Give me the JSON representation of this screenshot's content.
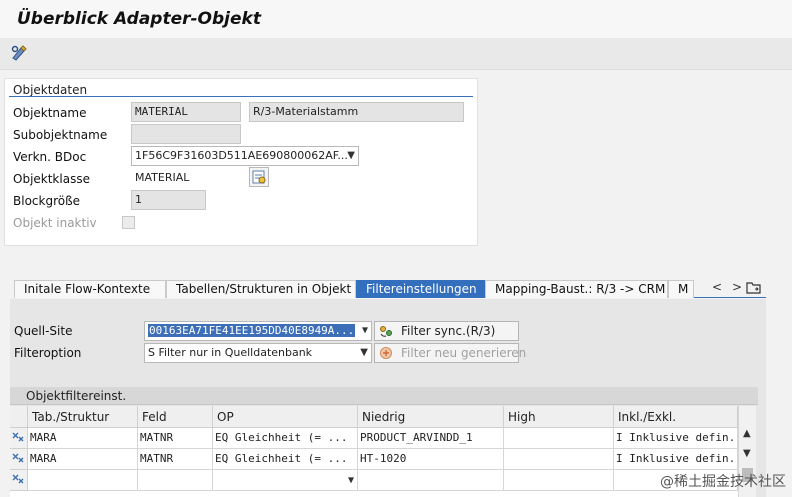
{
  "header": {
    "title": "Überblick Adapter-Objekt"
  },
  "toolbar": {
    "icon": "display-change-icon"
  },
  "objektdaten": {
    "section_title": "Objektdaten",
    "objektname": {
      "label": "Objektname",
      "value": "MATERIAL",
      "description": "R/3-Materialstamm"
    },
    "subobjektname": {
      "label": "Subobjektname",
      "value": ""
    },
    "verkn_bdoc": {
      "label": "Verkn. BDoc",
      "value": "1F56C9F31603D511AE690800062AF..."
    },
    "objektklasse": {
      "label": "Objektklasse",
      "value": "MATERIAL"
    },
    "blockgroesse": {
      "label": "Blockgröße",
      "value": "1"
    },
    "objekt_inaktiv": {
      "label": "Objekt inaktiv",
      "checked": false
    }
  },
  "tabs": [
    {
      "label": "Initale Flow-Kontexte",
      "active": false
    },
    {
      "label": "Tabellen/Strukturen in Objekt",
      "active": false
    },
    {
      "label": "Filtereinstellungen",
      "active": true
    },
    {
      "label": "Mapping-Baust.: R/3 -> CRM",
      "active": false
    },
    {
      "label": "M",
      "active": false
    }
  ],
  "tab_nav": {
    "left": "<",
    "right": ">"
  },
  "filter": {
    "quell_site": {
      "label": "Quell-Site",
      "value": "00163EA71FE41EE195DD40E8949A..."
    },
    "filteroption": {
      "label": "Filteroption",
      "value": "S Filter nur in Quelldatenbank"
    },
    "btn_sync": {
      "label": "Filter sync.(R/3)"
    },
    "btn_regen": {
      "label": "Filter neu generieren"
    }
  },
  "grid": {
    "title": "Objektfiltereinst.",
    "columns": [
      "Tab./Struktur",
      "Feld",
      "OP",
      "Niedrig",
      "High",
      "Inkl./Exkl."
    ],
    "rows": [
      [
        "MARA",
        "MATNR",
        "EQ Gleichheit (= ...",
        "PRODUCT_ARVINDD_1",
        "",
        "I Inklusive defin..."
      ],
      [
        "MARA",
        "MATNR",
        "EQ Gleichheit (= ...",
        "HT-1020",
        "",
        "I Inklusive defin..."
      ],
      [
        "",
        "",
        "",
        "",
        "",
        ""
      ]
    ]
  },
  "watermark": "@稀土掘金技术社区",
  "colors": {
    "accent": "#346fbd",
    "panel": "#ffffff",
    "background": "#f2f2f2"
  }
}
